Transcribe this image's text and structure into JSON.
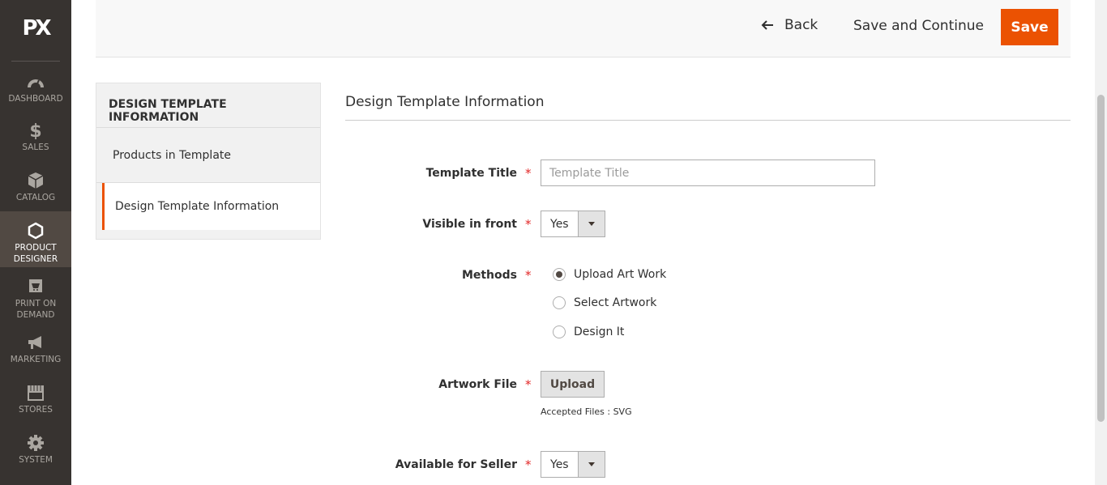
{
  "nav": {
    "logo": "PX",
    "items": [
      {
        "label": "DASHBOARD",
        "icon": "dashboard-icon"
      },
      {
        "label": "SALES",
        "icon": "dollar-icon"
      },
      {
        "label": "CATALOG",
        "icon": "box-icon"
      },
      {
        "label": "PRODUCT DESIGNER",
        "icon": "hexagon-icon",
        "active": true
      },
      {
        "label": "PRINT ON DEMAND",
        "icon": "cart-icon"
      },
      {
        "label": "MARKETING",
        "icon": "megaphone-icon"
      },
      {
        "label": "STORES",
        "icon": "store-icon"
      },
      {
        "label": "SYSTEM",
        "icon": "gear-icon"
      }
    ]
  },
  "header": {
    "back_label": "Back",
    "save_continue_label": "Save and Continue",
    "save_label": "Save",
    "accent_color": "#eb5202"
  },
  "tabs": {
    "title": "DESIGN TEMPLATE INFORMATION",
    "items": [
      {
        "label": "Products in Template"
      },
      {
        "label": "Design Template Information",
        "active": true
      }
    ]
  },
  "form": {
    "section_title": "Design Template Information",
    "template_title": {
      "label": "Template Title",
      "placeholder": "Template Title",
      "value": ""
    },
    "visible_in_front": {
      "label": "Visible in front",
      "value": "Yes"
    },
    "methods": {
      "label": "Methods",
      "options": [
        "Upload Art Work",
        "Select Artwork",
        "Design It"
      ],
      "selected": "Upload Art Work"
    },
    "artwork_file": {
      "label": "Artwork File",
      "button": "Upload",
      "note": "Accepted Files : SVG"
    },
    "available_for_seller": {
      "label": "Available for Seller",
      "value": "Yes"
    },
    "required_mark": "*"
  }
}
